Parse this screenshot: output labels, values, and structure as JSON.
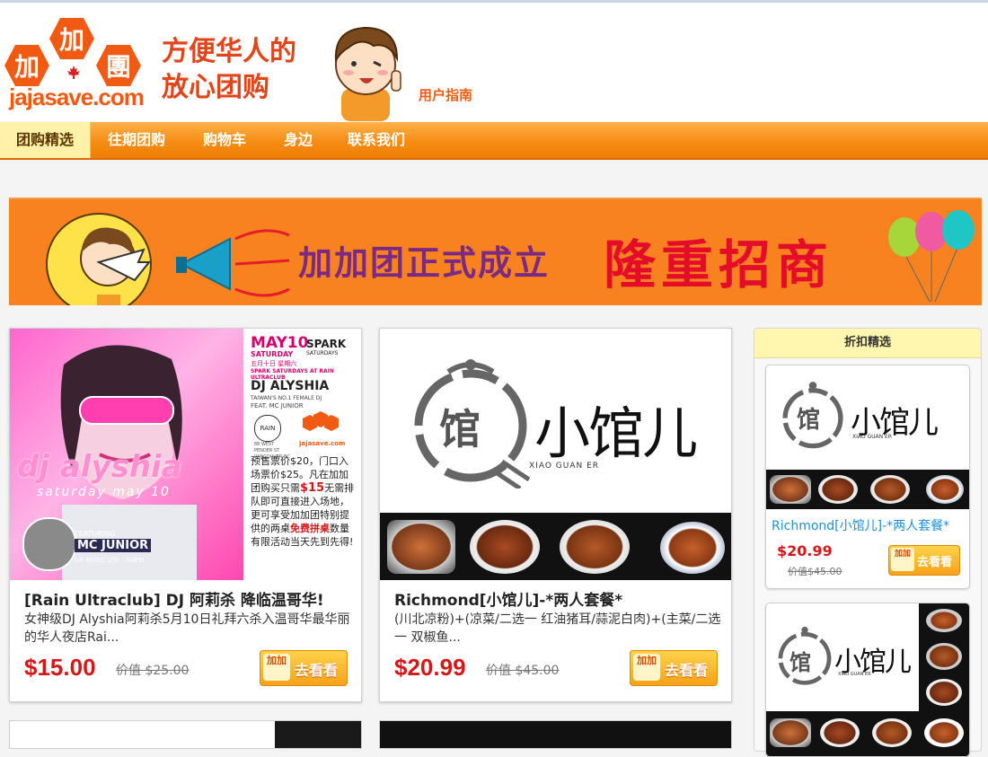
{
  "brand": {
    "logo_chars": [
      "加",
      "加",
      "團"
    ],
    "domain": "jajasave.com",
    "slogan_line1": "方便华人的",
    "slogan_line2": "放心团购",
    "guide_link": "用户指南",
    "orange": "#f05a12"
  },
  "nav": {
    "items": [
      {
        "label": "团购精选",
        "active": true
      },
      {
        "label": "往期团购"
      },
      {
        "label": "购物车"
      },
      {
        "label": "身边"
      },
      {
        "label": "联系我们"
      }
    ]
  },
  "banner": {
    "text1": "加加团正式成立",
    "text2": "隆重招商"
  },
  "deals": [
    {
      "title": "[Rain Ultraclub] DJ 阿莉杀 降临温哥华!",
      "desc": "女神级DJ Alyshia阿莉杀5月10日礼拜六杀入温哥华最华丽的华人夜店Rai...",
      "price": "$15.00",
      "orig": "价值 $25.00",
      "poster": {
        "date": "MAY10",
        "day": "SATURDAY",
        "cn_date": "五月十日 星期六",
        "brand": "SPARK",
        "brand_sub": "SATURDAYS",
        "event": "SPARK SATURDAYS AT RAIN ULTRACLUB",
        "dj": "DJ ALYSHIA",
        "dj_sub": "TAIWAN'S NO.1 FEMALE DJ",
        "feat": "FEAT. MC JUNIOR",
        "big": "dj alyshia",
        "big2": "saturday may 10",
        "featuring": "FEATURING",
        "mc": "MC JUNIOR",
        "mc_sub": "UR MUSIC LTD - TAIPEI",
        "rain": "RAIN",
        "addr": "88 WEST PENDER ST VANCOUVER BC",
        "promo_a": "预售票价$20，门口入场票价$25。凡在加加团购买只需",
        "promo_price": "$15",
        "promo_b": "无需排队即可直接进入场地，更可享受加加团特别提供的两桌",
        "promo_free": "免费拼桌",
        "promo_c": "数量有限活动当天先到先得!"
      }
    },
    {
      "title": "Richmond[小馆儿]-*两人套餐*",
      "desc": "(川北凉粉)+(凉菜/二选一 红油猪耳/蒜泥白肉)+(主菜/二选一 双椒鱼...",
      "price": "$20.99",
      "orig": "价值 $45.00",
      "logo_cn": "小馆儿",
      "logo_seal": "馆",
      "logo_en": "XIAO GUAN ER"
    }
  ],
  "go_button": {
    "badge": "加加",
    "label": "去看看"
  },
  "sidebar": {
    "title": "折扣精选",
    "items": [
      {
        "title": "Richmond[小馆儿]-*两人套餐*",
        "price": "$20.99",
        "orig": "价值$45.00",
        "logo_cn": "小馆儿",
        "logo_seal": "馆",
        "logo_en": "XIAO GUAN ER"
      },
      {
        "logo_cn": "小馆儿",
        "logo_seal": "馆",
        "logo_en": "XIAO GUAN ER"
      }
    ]
  }
}
